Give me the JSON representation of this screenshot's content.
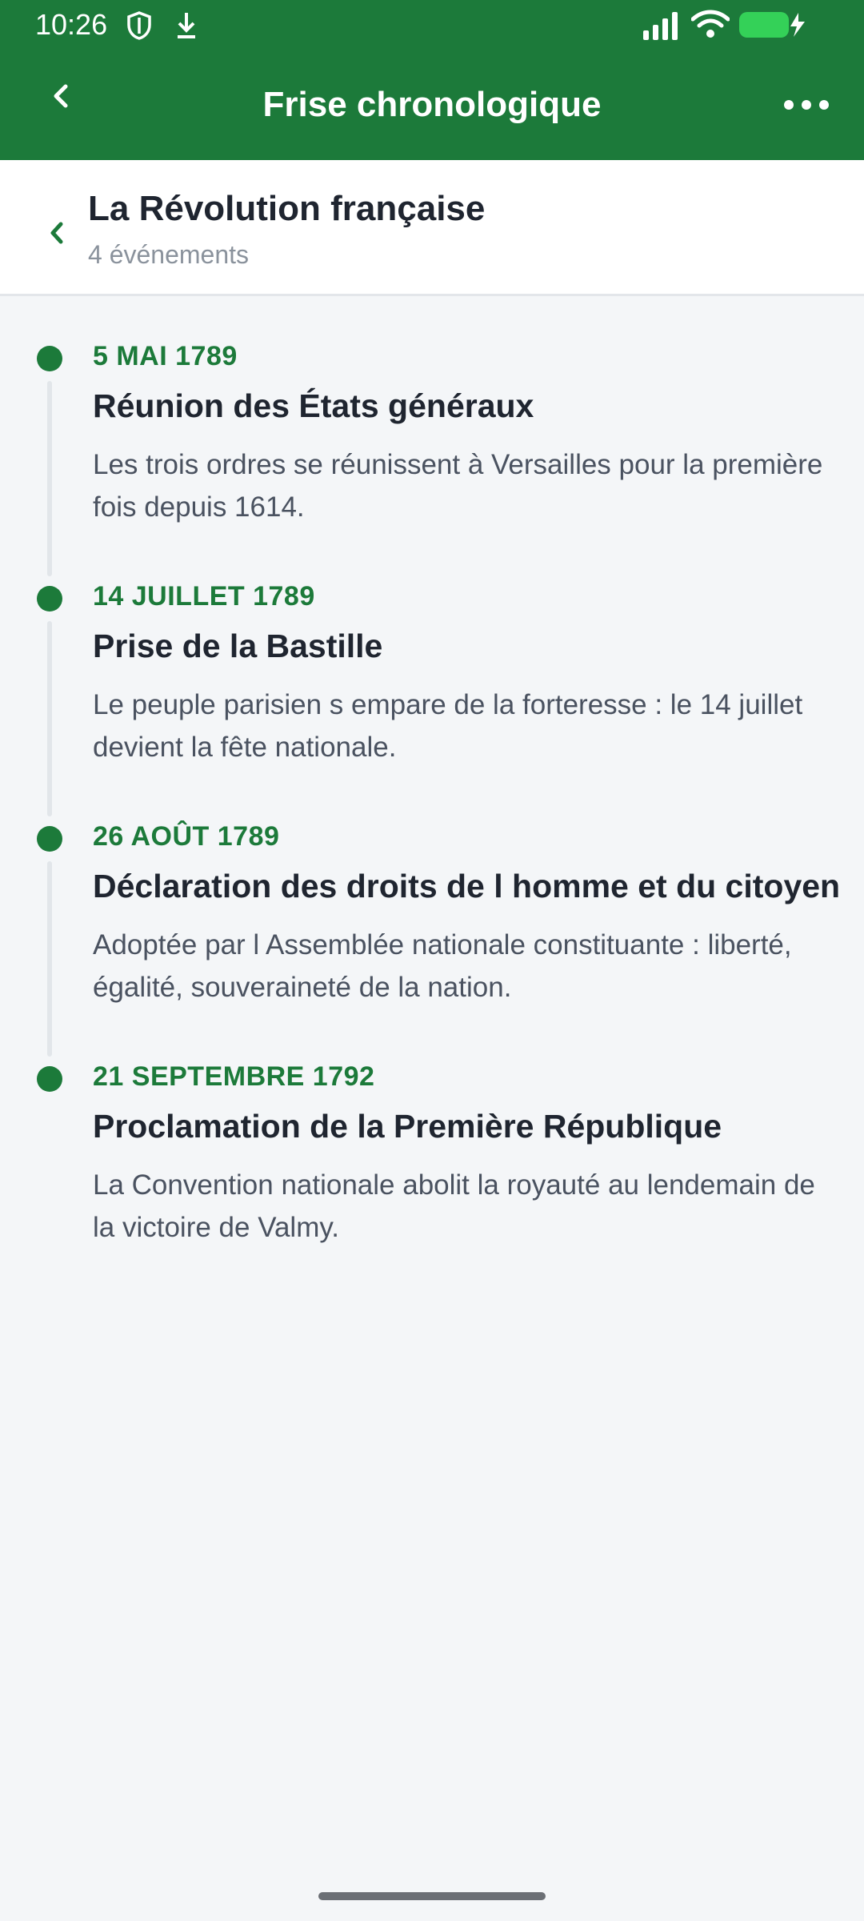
{
  "status_bar": {
    "time": "10:26",
    "icons": [
      "shield-icon",
      "download-icon",
      "signal-icon",
      "wifi-icon",
      "battery-charging-icon"
    ]
  },
  "app_bar": {
    "title": "Frise chronologique",
    "back_icon": "chevron-left-icon",
    "more_icon": "more-horizontal-icon"
  },
  "section": {
    "title": "La Révolution française",
    "count": "4 événements"
  },
  "events": [
    {
      "date": "5 MAI 1789",
      "title": "Réunion des États généraux",
      "description": "Les trois ordres se réunissent à Versailles pour la première fois depuis 1614."
    },
    {
      "date": "14 JUILLET 1789",
      "title": "Prise de la Bastille",
      "description": "Le peuple parisien s empare de la forteresse : le 14 juillet devient la fête nationale."
    },
    {
      "date": "26 AOÛT 1789",
      "title": "Déclaration des droits de l homme et du citoyen",
      "description": "Adoptée par l Assemblée nationale constituante : liberté, égalité, souveraineté de la nation."
    },
    {
      "date": "21 SEPTEMBRE 1792",
      "title": "Proclamation de la Première République",
      "description": "La Convention nationale abolit la royauté au lendemain de la victoire de Valmy."
    }
  ],
  "colors": {
    "accent": "#1c7a3a",
    "background": "#f4f6f8",
    "title_text": "#1f2530",
    "body_text": "#4a5260",
    "muted_text": "#8a929c",
    "timeline_line": "#e2e6ea"
  }
}
